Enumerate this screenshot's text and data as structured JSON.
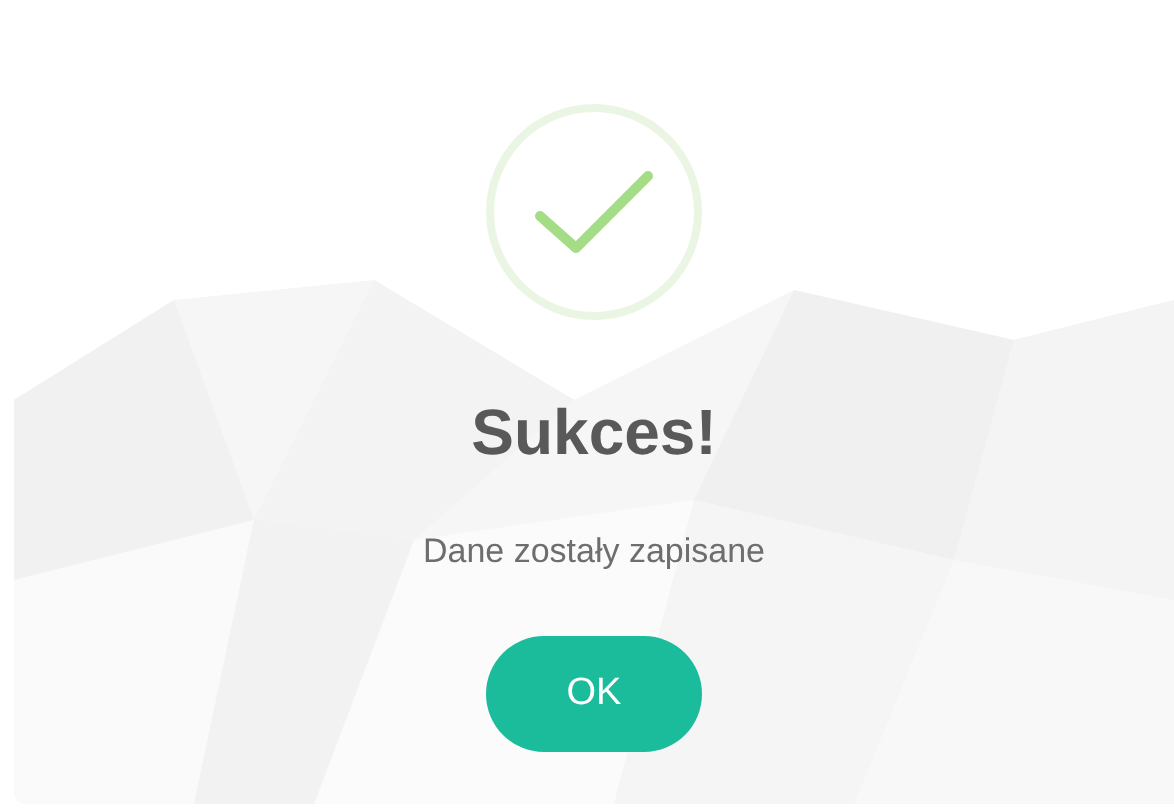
{
  "dialog": {
    "title": "Sukces!",
    "message": "Dane zostały zapisane",
    "button": "OK"
  }
}
